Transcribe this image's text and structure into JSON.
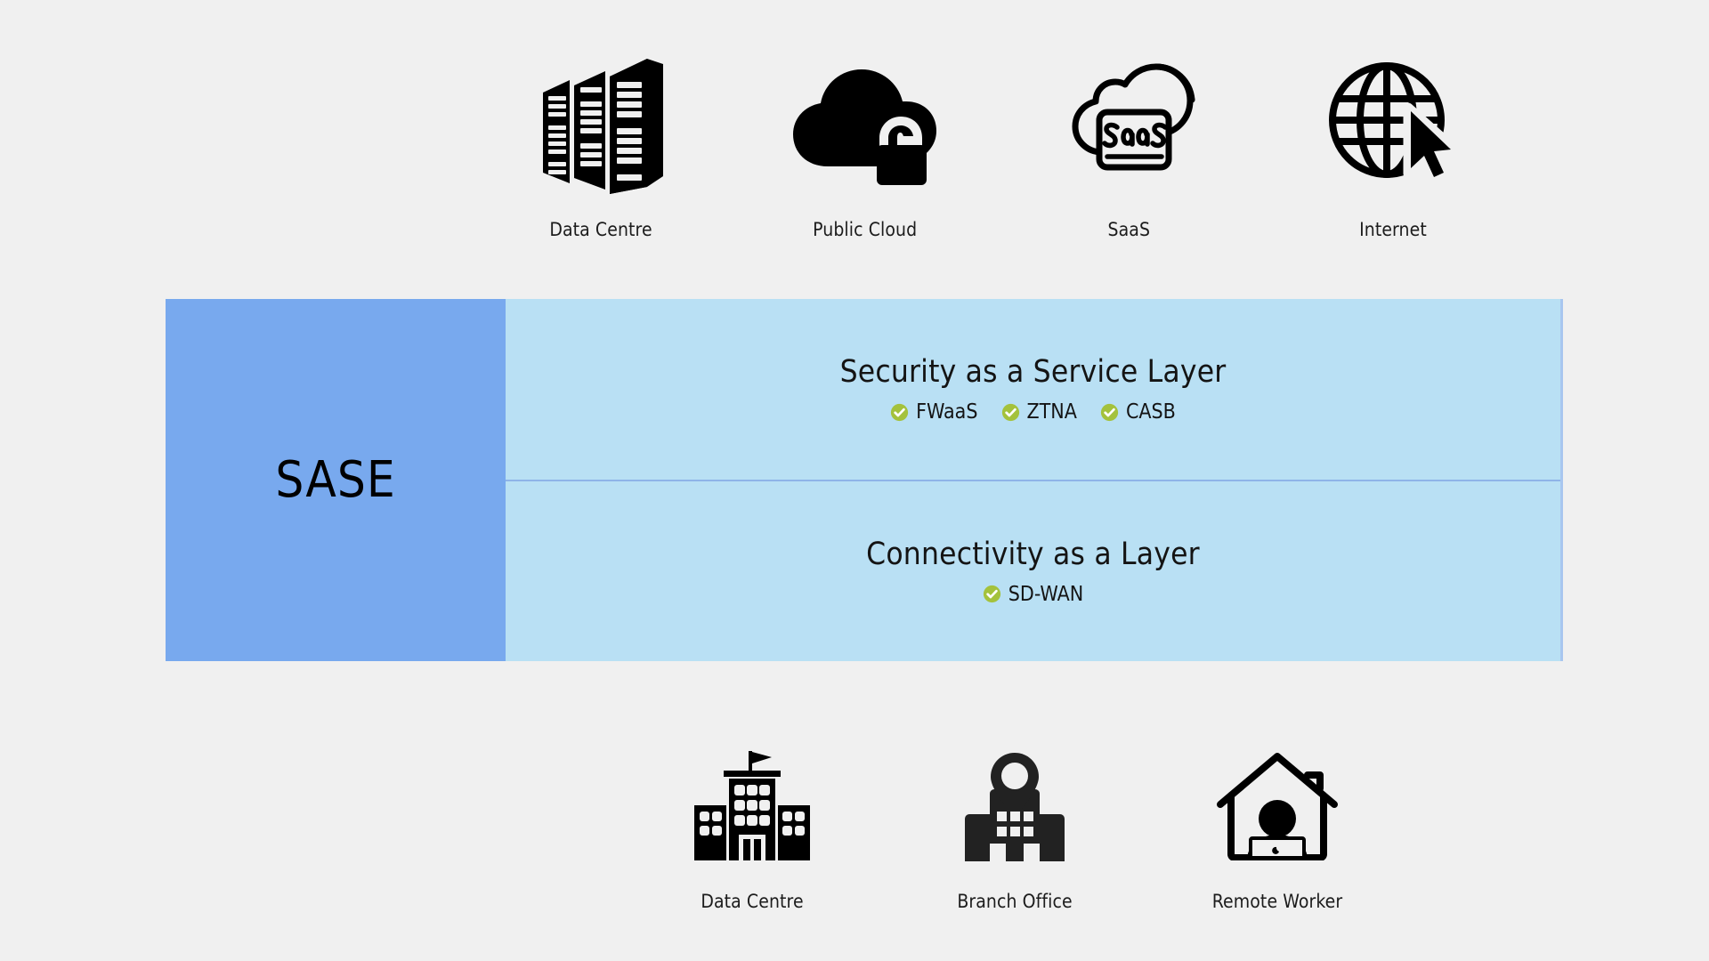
{
  "colors": {
    "background": "#f0f0f0",
    "sase_key_fill": "#78a9ee",
    "layer_fill": "#b9e0f4",
    "layer_divider": "#8fb4e8",
    "band_border": "#a8c6ef",
    "check_badge": "#a4c23c",
    "check_mark": "#ffffff",
    "icon_black": "#000000",
    "text": "#141414"
  },
  "top_nodes": [
    {
      "label": "Data Centre",
      "icon": "server-racks-icon"
    },
    {
      "label": "Public Cloud",
      "icon": "cloud-unlock-icon"
    },
    {
      "label": "SaaS",
      "icon": "saas-cloud-icon"
    },
    {
      "label": "Internet",
      "icon": "globe-cursor-icon"
    }
  ],
  "bottom_nodes": [
    {
      "label": "Data Centre",
      "icon": "office-building-flag-icon"
    },
    {
      "label": "Branch Office",
      "icon": "building-location-pin-icon"
    },
    {
      "label": "Remote Worker",
      "icon": "house-laptop-person-icon"
    }
  ],
  "sase": {
    "key_label": "SASE",
    "layers": [
      {
        "title": "Security as a Service Layer",
        "badges": [
          "FWaaS",
          "ZTNA",
          "CASB"
        ]
      },
      {
        "title": "Connectivity as a Layer",
        "badges": [
          "SD-WAN"
        ]
      }
    ]
  }
}
